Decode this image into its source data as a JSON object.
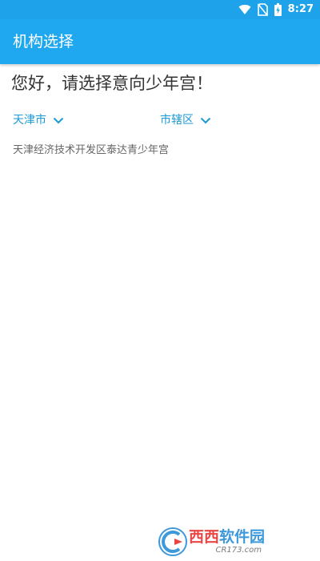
{
  "status_bar": {
    "time": "8:27",
    "icons": [
      "wifi-icon",
      "no-sim-icon",
      "battery-charging-icon"
    ]
  },
  "app_bar": {
    "title": "机构选择"
  },
  "greeting": "您好，请选择意向少年宫！",
  "filters": {
    "city": {
      "value": "天津市",
      "icon": "chevron-down-icon"
    },
    "district": {
      "value": "市辖区",
      "icon": "chevron-down-icon"
    }
  },
  "organizations": [
    {
      "name": "天津经济技术开发区泰达青少年宫"
    }
  ],
  "watermark": {
    "name_accent": "西西",
    "name_rest": "软件园",
    "site": "CR173.com"
  },
  "colors": {
    "primary": "#1fa8ef",
    "accent_text": "#1a9ad6",
    "background": "#ffffff"
  }
}
